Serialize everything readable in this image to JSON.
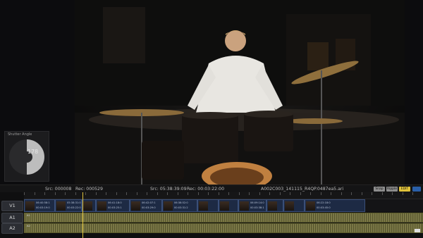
{
  "shutter": {
    "title": "Shutter Angle",
    "value": "178"
  },
  "status": {
    "src_tc": "Src: 000008",
    "rec_tc": "Rec: 000529",
    "src_time": "Src: 05:38:39:09",
    "rec_time": "Rec: 00:03:22:00",
    "clip_name": "A002C003_141115_R4QP.0487ea5.ari",
    "buttons": [
      "Snap",
      "Ripple",
      "EDIT"
    ],
    "accent": "#e0c23a"
  },
  "tracks": {
    "v1_label": "V1",
    "a1_label": "A1",
    "a2_label": "A2",
    "a1_channel": "A1",
    "a2_channel": "A2"
  },
  "clips": [
    {
      "tc_in": "06:40:58:1",
      "tc_out": "00:03:19:0"
    },
    {
      "tc_in": "05:38:31:0",
      "tc_out": "00:03:22:0"
    },
    {
      "tc_in": "",
      "tc_out": ""
    },
    {
      "tc_in": "06:41:18:0",
      "tc_out": "00:03:25:1"
    },
    {
      "tc_in": "06:42:07:1",
      "tc_out": "00:03:29:0"
    },
    {
      "tc_in": "06:38:52:0",
      "tc_out": "00:03:31:2"
    },
    {
      "tc_in": "",
      "tc_out": ""
    },
    {
      "tc_in": "",
      "tc_out": ""
    },
    {
      "tc_in": "06:09:14:0",
      "tc_out": "00:03:38:1"
    },
    {
      "tc_in": "",
      "tc_out": ""
    },
    {
      "tc_in": "",
      "tc_out": ""
    },
    {
      "tc_in": "06:22:18:0",
      "tc_out": "00:03:45:0"
    }
  ]
}
